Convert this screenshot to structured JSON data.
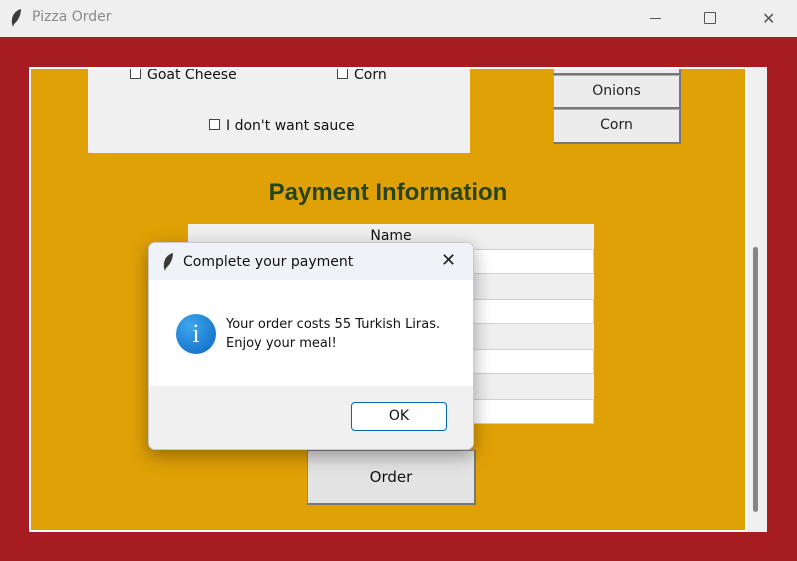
{
  "app": {
    "title": "Pizza Order",
    "icon": "feather-icon"
  },
  "window_controls": {
    "minimize_icon": "minimize-icon",
    "maximize_icon": "maximize-icon",
    "close_symbol": "✕"
  },
  "toppings": {
    "checkboxes": [
      {
        "label": "Goat Cheese",
        "checked": false
      },
      {
        "label": "Corn",
        "checked": false
      },
      {
        "label": "I don't want sauce",
        "checked": false
      }
    ],
    "buttons": [
      "Onions",
      "Corn"
    ]
  },
  "payment": {
    "title": "Payment Information",
    "fields": [
      {
        "label": "Name",
        "value": ""
      },
      {
        "label": "",
        "value": ""
      },
      {
        "label": "",
        "value": ""
      },
      {
        "label": "",
        "value": ""
      }
    ],
    "order_label": "Order"
  },
  "dialog": {
    "title": "Complete your payment",
    "close_symbol": "✕",
    "info_glyph": "i",
    "message_line1": "Your order costs 55 Turkish Liras.",
    "message_line2": "Enjoy your meal!",
    "ok_label": "OK"
  },
  "colors": {
    "frame": "#a71c20",
    "canvas": "#e0a107",
    "title_text": "#28441a",
    "ok_border": "#0067c0"
  }
}
